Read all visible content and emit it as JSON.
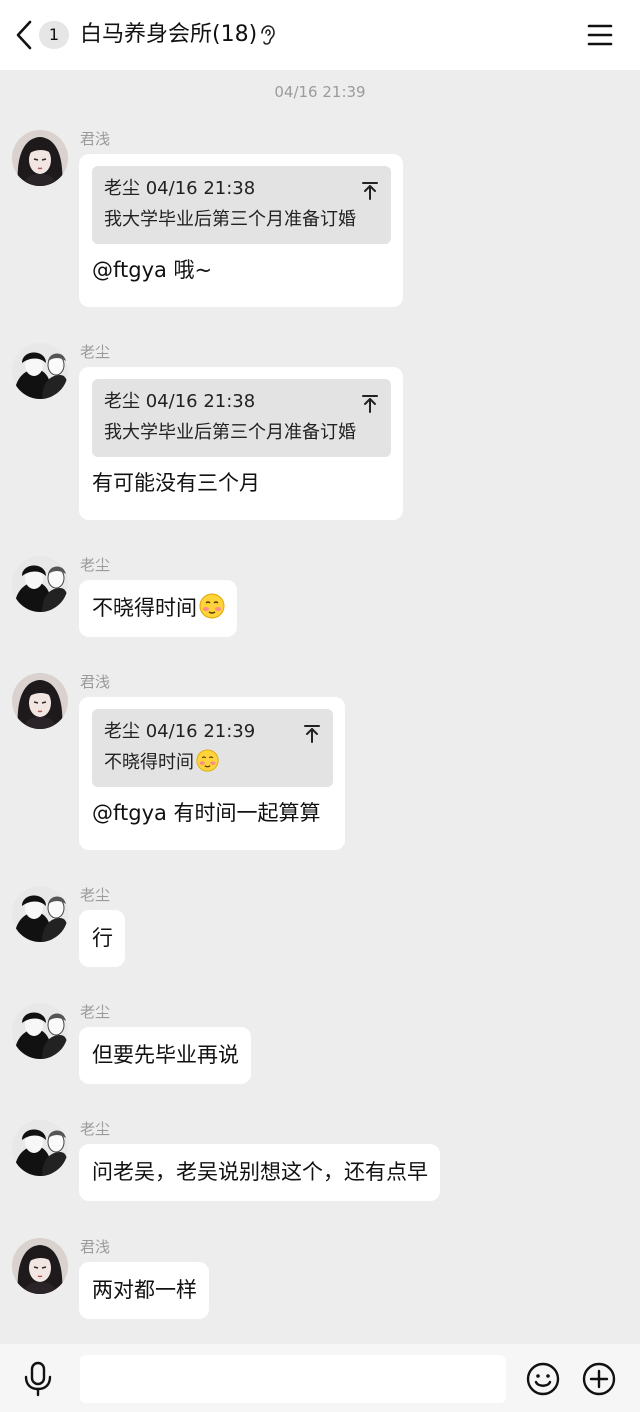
{
  "header": {
    "unread_count": "1",
    "title": "白马养身会所(18)",
    "back_icon": "chevron-left-icon",
    "ear_icon": "ear-icon",
    "menu_icon": "menu-icon"
  },
  "chat": {
    "timestamp": "04/16 21:39",
    "messages": [
      {
        "sender": "君浅",
        "avatar": "girl-avatar",
        "quote": {
          "head": "老尘 04/16 21:38",
          "body": "我大学毕业后第三个月准备订婚"
        },
        "text": "@ftgya 哦~"
      },
      {
        "sender": "老尘",
        "avatar": "boy-avatar",
        "quote": {
          "head": "老尘 04/16 21:38",
          "body": "我大学毕业后第三个月准备订婚"
        },
        "text": "有可能没有三个月"
      },
      {
        "sender": "老尘",
        "avatar": "boy-avatar",
        "text": "不晓得时间",
        "emoji": "shy-face-emoji"
      },
      {
        "sender": "君浅",
        "avatar": "girl-avatar",
        "quote": {
          "head": "老尘 04/16 21:39",
          "body": "不晓得时间",
          "emoji": "shy-face-emoji"
        },
        "text": "@ftgya 有时间一起算算"
      },
      {
        "sender": "老尘",
        "avatar": "boy-avatar",
        "text": "行"
      },
      {
        "sender": "老尘",
        "avatar": "boy-avatar",
        "text": "但要先毕业再说"
      },
      {
        "sender": "老尘",
        "avatar": "boy-avatar",
        "text": "问老吴，老吴说别想这个，还有点早"
      },
      {
        "sender": "君浅",
        "avatar": "girl-avatar",
        "text": "两对都一样"
      }
    ]
  },
  "input_bar": {
    "voice_icon": "microphone-icon",
    "input_value": "",
    "emoji_icon": "smiley-icon",
    "plus_icon": "plus-circle-icon"
  },
  "colors": {
    "chat_background": "#ededed",
    "bubble": "#ffffff",
    "quote_background": "#e3e3e3",
    "meta_text": "#9b9b9b"
  }
}
